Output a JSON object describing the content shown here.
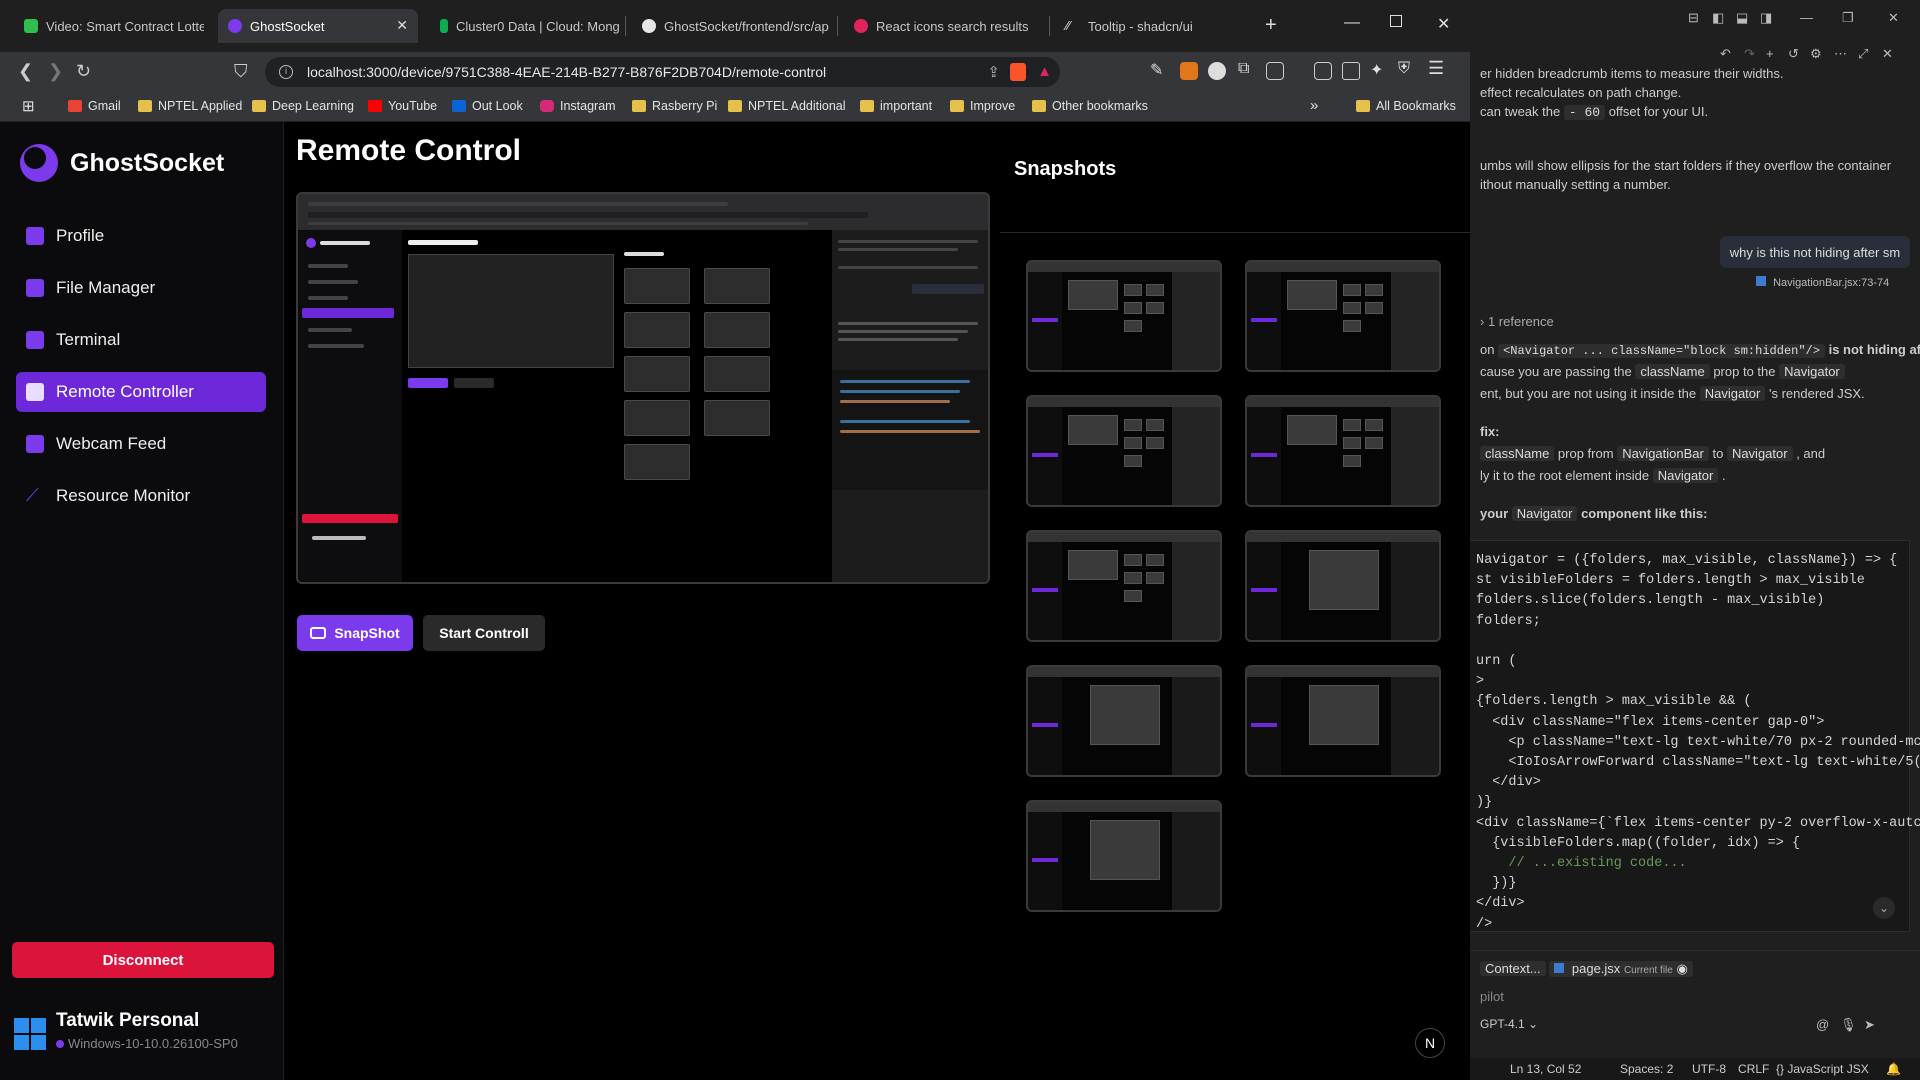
{
  "browser": {
    "tabs": [
      {
        "title": "Video: Smart Contract Lottery",
        "color": "#2fbf4f"
      },
      {
        "title": "GhostSocket",
        "color": "#7c3aed",
        "active": true
      },
      {
        "title": "Cluster0 Data | Cloud: Mongo",
        "color": "#10aa50"
      },
      {
        "title": "GhostSocket/frontend/src/ap",
        "color": "#e6e6e6"
      },
      {
        "title": "React icons search results",
        "color": "#e0245e"
      },
      {
        "title": "Tooltip - shadcn/ui",
        "color": "#dddddd"
      }
    ],
    "url": "localhost:3000/device/9751C388-4EAE-214B-B277-B876F2DB704D/remote-control",
    "bookmarks": [
      {
        "label": "Gmail",
        "icon": "gmail-icon"
      },
      {
        "label": "NPTEL Applied",
        "icon": "folder-icon"
      },
      {
        "label": "Deep Learning",
        "icon": "folder-icon"
      },
      {
        "label": "YouTube",
        "icon": "youtube-icon"
      },
      {
        "label": "Out Look",
        "icon": "outlook-icon"
      },
      {
        "label": "Instagram",
        "icon": "instagram-icon"
      },
      {
        "label": "Rasberry Pi",
        "icon": "folder-icon"
      },
      {
        "label": "NPTEL Additional",
        "icon": "folder-icon"
      },
      {
        "label": "important",
        "icon": "folder-icon"
      },
      {
        "label": "Improve",
        "icon": "folder-icon"
      },
      {
        "label": "Other bookmarks",
        "icon": "folder-icon"
      }
    ],
    "all_bookmarks": "All Bookmarks",
    "overflow": "»"
  },
  "app": {
    "brand": "GhostSocket",
    "nav": [
      {
        "label": "Profile",
        "icon": "profile-icon"
      },
      {
        "label": "File Manager",
        "icon": "folder-icon"
      },
      {
        "label": "Terminal",
        "icon": "terminal-icon"
      },
      {
        "label": "Remote Controller",
        "icon": "monitor-icon",
        "active": true
      },
      {
        "label": "Webcam Feed",
        "icon": "camera-icon"
      },
      {
        "label": "Resource Monitor",
        "icon": "chart-line-icon"
      }
    ],
    "disconnect": "Disconnect",
    "device_name": "Tatwik Personal",
    "device_os": "Windows-10-10.0.26100-SP0",
    "page_title": "Remote Control",
    "snapshot_btn": "SnapShot",
    "start_btn": "Start Controll",
    "snapshots_title": "Snapshots",
    "snapshot_count": 9,
    "badge": "N",
    "accent": "#7c3aed",
    "danger": "#dc143c"
  },
  "vscode": {
    "chat_lines": [
      "er hidden breadcrumb items to measure their widths.",
      "effect recalculates on path change.",
      "can tweak the",
      "offset for your UI."
    ],
    "offset_chip": "- 60",
    "ellipsis_line_1": "umbs will show ellipsis for the start folders if they overflow the container",
    "ellipsis_line_2": "ithout manually setting a number.",
    "user_question": "why is this not hiding after sm",
    "reference_file": "NavigationBar.jsx:73-74",
    "reference_count": "1 reference",
    "answer_prefix": "on",
    "answer_code": "<Navigator ... className=\"block sm:hidden\"/>",
    "answer_suffix": "is not hiding after",
    "answer_l2a": "cause you are passing the",
    "answer_l2b": "prop to the",
    "answer_l3a": "ent, but you are not using it inside the",
    "answer_l3b": "'s rendered JSX.",
    "fix_label": "fix:",
    "fix_l1a": "prop from",
    "fix_l1b": "to",
    "fix_l1c": ", and",
    "fix_l2": "ly it to the root element inside",
    "your_label": "your",
    "component_like": "component like this:",
    "chip_classname": "className",
    "chip_navigator": "Navigator",
    "chip_navbar": "NavigationBar",
    "code": [
      "Navigator = ({folders, max_visible, className}) => {",
      "st visibleFolders = folders.length > max_visible",
      "folders.slice(folders.length - max_visible)",
      "folders;",
      "",
      "urn (",
      ">",
      "{folders.length > max_visible && (",
      "  <div className=\"flex items-center gap-0\">",
      "    <p className=\"text-lg text-white/70 px-2 rounded-mc",
      "    <IoIosArrowForward className=\"text-lg text-white/5(",
      "  </div>",
      ")}",
      "<div className={`flex items-center py-2 overflow-x-autc",
      "  {visibleFolders.map((folder, idx) => {",
      "    // ...existing code...",
      "  })}",
      "</div>",
      "/>"
    ],
    "context_label": "Context...",
    "current_file": "page.jsx",
    "current_file_tag": "Current file",
    "pilot": "pilot",
    "model": "GPT-4.1",
    "status": {
      "position": "Ln 13, Col 52",
      "spaces": "Spaces: 2",
      "encoding": "UTF-8",
      "eol": "CRLF",
      "language": "JavaScript JSX"
    }
  }
}
